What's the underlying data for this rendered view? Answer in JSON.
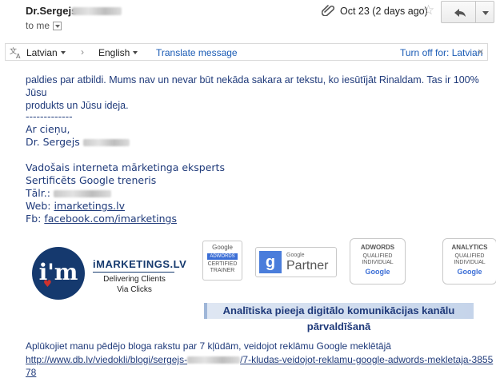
{
  "header": {
    "sender_name": "Dr.Sergejs",
    "recipient": "to me",
    "date": "Oct 23 (2 days ago)"
  },
  "translate_bar": {
    "from_language": "Latvian",
    "to_language": "English",
    "translate_link": "Translate message",
    "turn_off": "Turn off for: Latvian",
    "close": "×"
  },
  "message": {
    "paragraph_line1": "paldies par atbildi. Mums nav un nevar būt nekāda sakara ar tekstu, ko iesūtījāt Rinaldam. Tas ir 100% Jūsu",
    "paragraph_line2": "produkts un Jūsu ideja.",
    "separator": "-------------",
    "greeting": "Ar cieņu,",
    "signature_name": "Dr. Sergejs",
    "title_line1": "Vadošais interneta mārketinga eksperts",
    "title_line2": "Sertificēts Google treneris",
    "phone_label": "Tālr.:",
    "web_label": "Web:",
    "web_link": "imarketings.lv",
    "fb_label": "Fb:",
    "fb_link": "facebook.com/imarketings"
  },
  "logos": {
    "logo_letters": "i'm",
    "brand": "iMARKETINGS.LV",
    "tagline_line1": "Delivering Clients",
    "tagline_line2": "Via Clicks",
    "cert_google": "Google",
    "cert_adwords": "ADWORDS",
    "cert_line1": "CERTIFIED",
    "cert_line2": "TRAINER",
    "partner_google": "Google",
    "partner_label": "Partner",
    "adwords_title": "ADWORDS",
    "adwords_line1": "QUALIFIED",
    "adwords_line2": "INDIVIDUAL",
    "adwords_google": "Google",
    "analytics_title": "ANALYTICS",
    "analytics_line1": "QUALIFIED",
    "analytics_line2": "INDIVIDUAL",
    "analytics_google": "Google",
    "banner": "Analītiska pieeja digitālo komunikācijas kanālu pārvaldīšanā"
  },
  "footer": {
    "blog_text": "Aplūkojiet manu pēdējo bloga rakstu par 7 kļūdām, veidojot reklāmu Google meklētājā",
    "blog_link_part1": "http://www.db.lv/viedokli/blogi/sergejs-",
    "blog_link_part2": "/7-kludas-veidojot-reklamu-google-adwords-mekletaja-385578"
  },
  "colors": {
    "text_blue": "#1f3a7a",
    "link_blue": "#1a5bb5",
    "logo_navy": "#15396e"
  }
}
